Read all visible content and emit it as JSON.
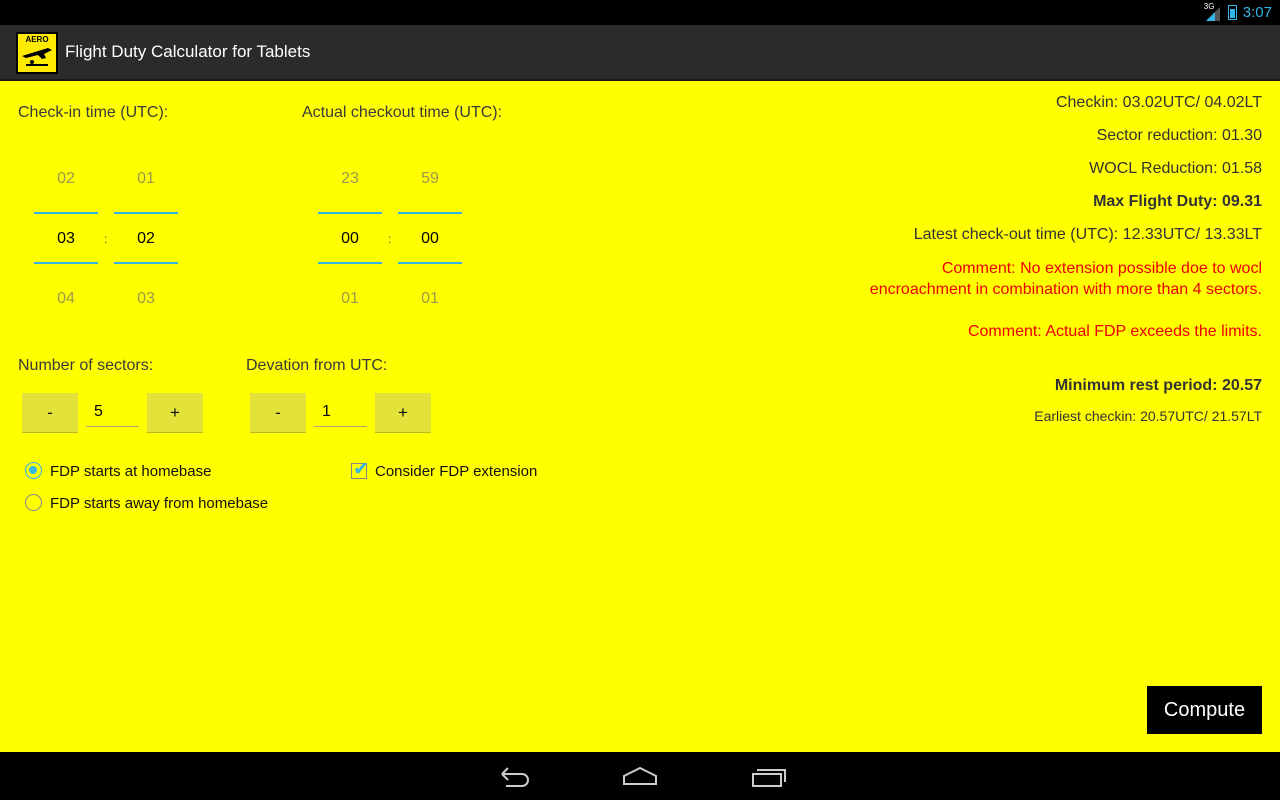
{
  "status_bar": {
    "network": "3G",
    "time": "3:07"
  },
  "action_bar": {
    "logo_text": "AERO",
    "title": "Flight Duty Calculator for Tablets"
  },
  "checkin": {
    "label": "Check-in time (UTC):",
    "hours": {
      "prev": "02",
      "value": "03",
      "next": "04"
    },
    "minutes": {
      "prev": "01",
      "value": "02",
      "next": "03"
    },
    "separator": ":"
  },
  "checkout": {
    "label": "Actual checkout time (UTC):",
    "hours": {
      "prev": "23",
      "value": "00",
      "next": "01"
    },
    "minutes": {
      "prev": "59",
      "value": "00",
      "next": "01"
    },
    "separator": ":"
  },
  "sectors": {
    "label": "Number of sectors:",
    "minus": "-",
    "value": "5",
    "plus": "+"
  },
  "deviation": {
    "label": "Devation from UTC:",
    "minus": "-",
    "value": "1",
    "plus": "+"
  },
  "options": {
    "radio_home": {
      "label": "FDP starts at homebase",
      "checked": true
    },
    "radio_away": {
      "label": "FDP starts away from homebase",
      "checked": false
    },
    "extension": {
      "label": "Consider FDP extension",
      "checked": true
    }
  },
  "results": {
    "checkin": "Checkin: 03.02UTC/ 04.02LT",
    "sector_reduction": "Sector reduction: 01.30",
    "wocl_reduction": "WOCL Reduction: 01.58",
    "max_flight_duty": "Max Flight Duty: 09.31",
    "latest_checkout": "Latest check-out time (UTC): 12.33UTC/ 13.33LT",
    "comment_1": "Comment: No extension possible doe to wocl encroachment in combination with more than 4 sectors.",
    "comment_2": "Comment: Actual FDP exceeds the limits.",
    "min_rest": "Minimum rest period: 20.57",
    "earliest_checkin": "Earliest checkin: 20.57UTC/ 21.57LT"
  },
  "compute_label": "Compute",
  "colors": {
    "background": "#ffff00",
    "accent": "#33b5e5",
    "warning": "#ee0000"
  }
}
